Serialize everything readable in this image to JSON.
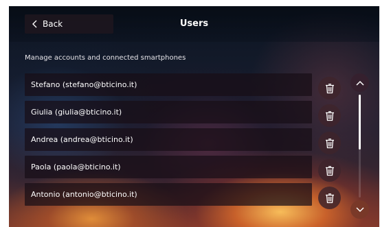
{
  "header": {
    "back_label": "Back",
    "title": "Users"
  },
  "subtitle": "Manage accounts and connected smartphones",
  "users": [
    {
      "label": "Stefano (stefano@bticino.it)"
    },
    {
      "label": "Giulia (giulia@bticino.it)"
    },
    {
      "label": "Andrea (andrea@bticino.it)"
    },
    {
      "label": "Paola (paola@bticino.it)"
    },
    {
      "label": "Antonio (antonio@bticino.it)"
    }
  ],
  "icons": {
    "back": "chevron-left-icon",
    "delete": "trash-icon",
    "scroll_up": "chevron-up-icon",
    "scroll_down": "chevron-down-icon"
  },
  "scroll": {
    "position_fraction": 0.0,
    "visible_fraction": 0.53
  },
  "colors": {
    "text": "#ffffff",
    "row_background": "#180e16",
    "accent": "#e8702a"
  }
}
